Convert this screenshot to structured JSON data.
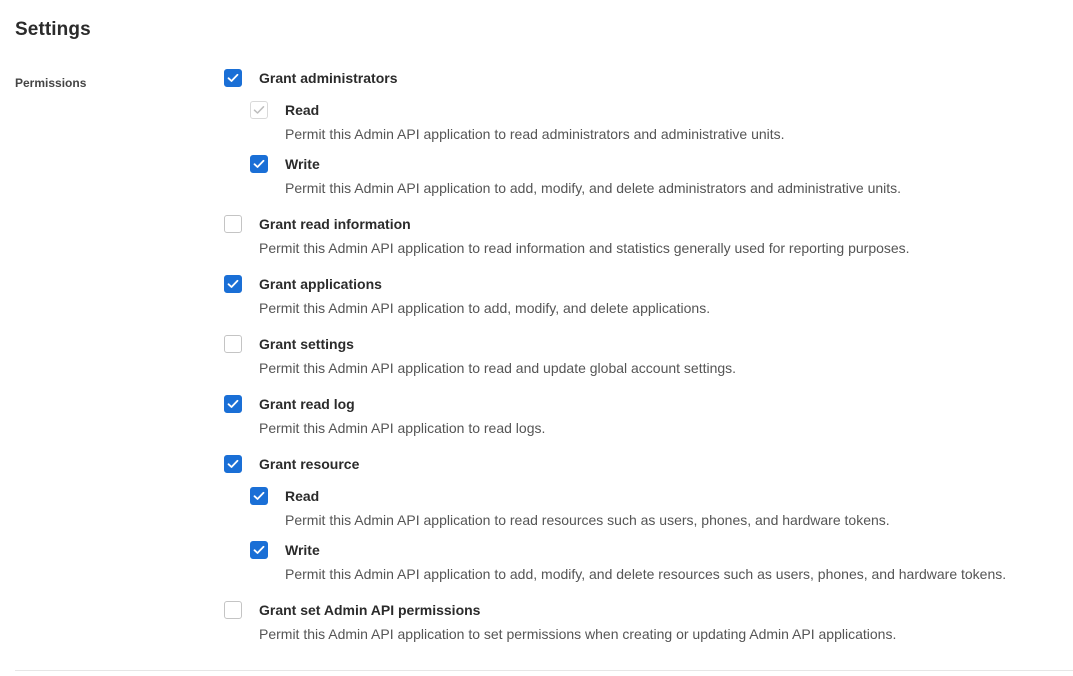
{
  "settings": {
    "title": "Settings",
    "permissions_label": "Permissions",
    "options": [
      {
        "label": "Grant administrators",
        "checked": true,
        "children": [
          {
            "label": "Read",
            "description": "Permit this Admin API application to read administrators and administrative units.",
            "state": "checked-disabled"
          },
          {
            "label": "Write",
            "description": "Permit this Admin API application to add, modify, and delete administrators and administrative units.",
            "state": "checked"
          }
        ]
      },
      {
        "label": "Grant read information",
        "description": "Permit this Admin API application to read information and statistics generally used for reporting purposes.",
        "checked": false
      },
      {
        "label": "Grant applications",
        "description": "Permit this Admin API application to add, modify, and delete applications.",
        "checked": true
      },
      {
        "label": "Grant settings",
        "description": "Permit this Admin API application to read and update global account settings.",
        "checked": false
      },
      {
        "label": "Grant read log",
        "description": "Permit this Admin API application to read logs.",
        "checked": true
      },
      {
        "label": "Grant resource",
        "checked": true,
        "children": [
          {
            "label": "Read",
            "description": "Permit this Admin API application to read resources such as users, phones, and hardware tokens.",
            "state": "checked"
          },
          {
            "label": "Write",
            "description": "Permit this Admin API application to add, modify, and delete resources such as users, phones, and hardware tokens.",
            "state": "checked"
          }
        ]
      },
      {
        "label": "Grant set Admin API permissions",
        "description": "Permit this Admin API application to set permissions when creating or updating Admin API applications.",
        "checked": false
      }
    ]
  },
  "colors": {
    "accent": "#1a6fd6",
    "checkbox_border": "#c4c4c4",
    "disabled_check": "#bdbdbd"
  }
}
